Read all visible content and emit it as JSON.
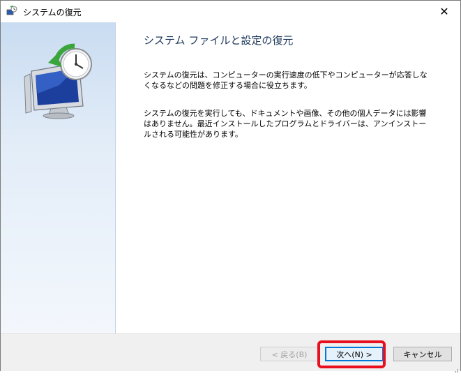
{
  "window": {
    "title": "システムの復元",
    "close_glyph": "✕"
  },
  "content": {
    "heading": "システム ファイルと設定の復元",
    "paragraph1": "システムの復元は、コンピューターの実行速度の低下やコンピューターが応答しなくなるなどの問題を修正する場合に役立ちます。",
    "paragraph2": "システムの復元を実行しても、ドキュメントや画像、その他の個人データには影響はありません。最近インストールしたプログラムとドライバーは、アンインストールされる可能性があります。"
  },
  "footer": {
    "back_label": "< 戻る(B)",
    "next_label": "次へ(N) >",
    "cancel_label": "キャンセル"
  },
  "colors": {
    "heading": "#1e395b",
    "highlight": "#e8101f",
    "accent": "#0078d7"
  },
  "icons": {
    "title": "system-restore-icon",
    "illustration": "restore-monitor-clock-icon"
  }
}
